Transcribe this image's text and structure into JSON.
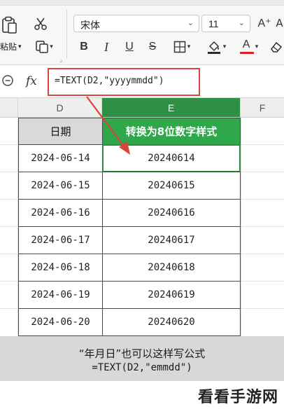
{
  "ribbon": {
    "paste_label": "粘贴",
    "font_name": "宋体",
    "font_size": "11",
    "icons": [
      "paste-icon",
      "cut-icon",
      "format-painter-icon",
      "bold-icon",
      "italic-icon",
      "underline-icon",
      "strikethrough-icon",
      "borders-icon",
      "fill-color-icon",
      "font-color-icon",
      "grow-font-icon",
      "clear-format-icon",
      "dialog-launcher-icon"
    ],
    "font_color_accent": "#d9251d",
    "buttons": {
      "bold": "B",
      "italic": "I",
      "underline": "U",
      "strike": "S",
      "grow_font": "A⁺",
      "font_color_letter": "A"
    }
  },
  "formula_bar": {
    "fx_label": "fx",
    "formula": "=TEXT(D2,\"yyyymmdd\")",
    "highlight_color": "#d9453d"
  },
  "columns": {
    "d": "D",
    "e": "E",
    "f": "F"
  },
  "table": {
    "header_d": "日期",
    "header_e": "转换为8位数字样式",
    "rows": [
      {
        "date": "2024-06-14",
        "num": "20240614"
      },
      {
        "date": "2024-06-15",
        "num": "20240615"
      },
      {
        "date": "2024-06-16",
        "num": "20240616"
      },
      {
        "date": "2024-06-17",
        "num": "20240617"
      },
      {
        "date": "2024-06-18",
        "num": "20240618"
      },
      {
        "date": "2024-06-19",
        "num": "20240619"
      },
      {
        "date": "2024-06-20",
        "num": "20240620"
      }
    ],
    "header_e_color": "#2ea84a",
    "active_column_color": "#2f8f47"
  },
  "caption": {
    "line1": "“年月日”也可以这样写公式",
    "line2": "=TEXT(D2,\"emmdd\")"
  },
  "watermark": "看看手游网"
}
